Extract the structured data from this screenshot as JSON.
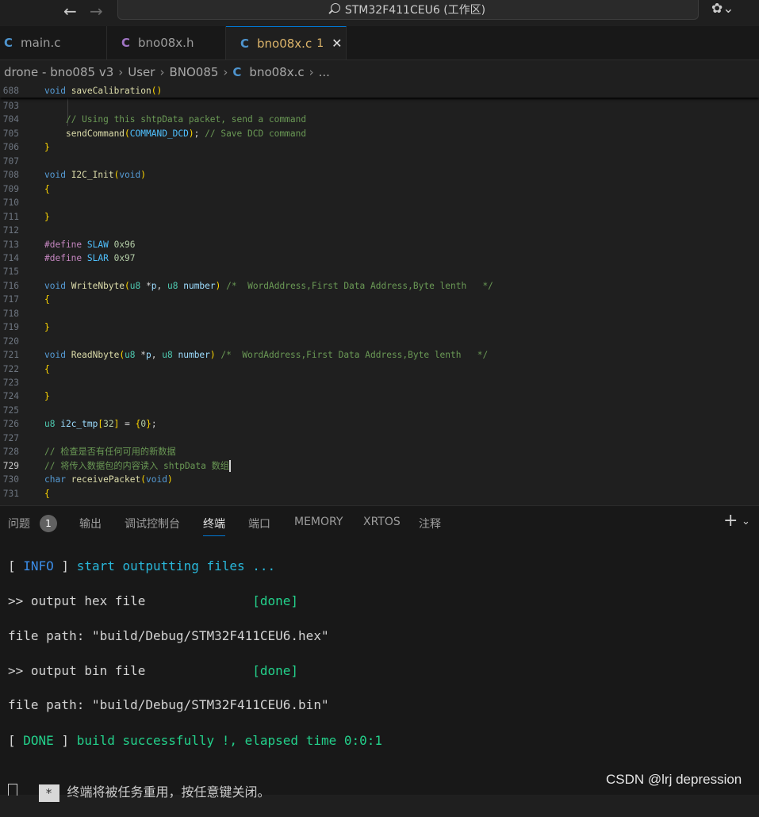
{
  "titlebar": {
    "command_center": "STM32F411CEU6 (工作区)",
    "back_glyph": "←",
    "forward_glyph": "→",
    "copilot_glyph": "✿⌄"
  },
  "tabs": [
    {
      "label": "main.c",
      "icon": "C"
    },
    {
      "label": "bno08x.h",
      "icon": "C"
    },
    {
      "label": "bno08x.c",
      "icon": "C",
      "badge": "1",
      "active": true
    }
  ],
  "colors": {
    "c_icon_source": "#4e94ce",
    "c_icon_header": "#a074c4",
    "accent": "#0078d4",
    "modified": "#dcb46a"
  },
  "breadcrumb": {
    "items": [
      "drone - bno085 v3",
      "User",
      "BNO085"
    ],
    "file_icon": "C",
    "file": "bno08x.c",
    "tail": "..."
  },
  "editor": {
    "sticky": {
      "num": "688",
      "code": [
        [
          "kw",
          "void "
        ],
        [
          "fn",
          "saveCalibration"
        ],
        [
          "pr",
          "()"
        ]
      ]
    },
    "lines": [
      {
        "num": "703",
        "code": []
      },
      {
        "num": "704",
        "code": [
          [
            "tx",
            "    "
          ],
          [
            "cm",
            "// Using this shtpData packet, send a command"
          ]
        ]
      },
      {
        "num": "705",
        "code": [
          [
            "tx",
            "    "
          ],
          [
            "fn",
            "sendCommand"
          ],
          [
            "pr",
            "("
          ],
          [
            "cn",
            "COMMAND_DCD"
          ],
          [
            "pr",
            ")"
          ],
          [
            "tx",
            "; "
          ],
          [
            "cm",
            "// Save DCD command"
          ]
        ]
      },
      {
        "num": "706",
        "code": [
          [
            "pr",
            "}"
          ]
        ]
      },
      {
        "num": "707",
        "code": []
      },
      {
        "num": "708",
        "code": [
          [
            "kw",
            "void "
          ],
          [
            "fn",
            "I2C_Init"
          ],
          [
            "pr",
            "("
          ],
          [
            "kw",
            "void"
          ],
          [
            "pr",
            ")"
          ]
        ]
      },
      {
        "num": "709",
        "code": [
          [
            "pr",
            "{"
          ]
        ]
      },
      {
        "num": "710",
        "code": []
      },
      {
        "num": "711",
        "code": [
          [
            "pr",
            "}"
          ]
        ]
      },
      {
        "num": "712",
        "code": []
      },
      {
        "num": "713",
        "code": [
          [
            "mc",
            "#define "
          ],
          [
            "cn",
            "SLAW "
          ],
          [
            "nm",
            "0x96"
          ]
        ]
      },
      {
        "num": "714",
        "code": [
          [
            "mc",
            "#define "
          ],
          [
            "cn",
            "SLAR "
          ],
          [
            "nm",
            "0x97"
          ]
        ]
      },
      {
        "num": "715",
        "code": []
      },
      {
        "num": "716",
        "code": [
          [
            "kw",
            "void "
          ],
          [
            "fn",
            "WriteNbyte"
          ],
          [
            "pr",
            "("
          ],
          [
            "tp",
            "u8 "
          ],
          [
            "tx",
            "*"
          ],
          [
            "vr",
            "p"
          ],
          [
            "tx",
            ", "
          ],
          [
            "tp",
            "u8 "
          ],
          [
            "vr",
            "number"
          ],
          [
            "pr",
            ")"
          ],
          [
            "tx",
            " "
          ],
          [
            "cm",
            "/*  WordAddress,First Data Address,Byte lenth   */"
          ]
        ]
      },
      {
        "num": "717",
        "code": [
          [
            "pr",
            "{"
          ]
        ]
      },
      {
        "num": "718",
        "code": []
      },
      {
        "num": "719",
        "code": [
          [
            "pr",
            "}"
          ]
        ]
      },
      {
        "num": "720",
        "code": []
      },
      {
        "num": "721",
        "code": [
          [
            "kw",
            "void "
          ],
          [
            "fn",
            "ReadNbyte"
          ],
          [
            "pr",
            "("
          ],
          [
            "tp",
            "u8 "
          ],
          [
            "tx",
            "*"
          ],
          [
            "vr",
            "p"
          ],
          [
            "tx",
            ", "
          ],
          [
            "tp",
            "u8 "
          ],
          [
            "vr",
            "number"
          ],
          [
            "pr",
            ")"
          ],
          [
            "tx",
            " "
          ],
          [
            "cm",
            "/*  WordAddress,First Data Address,Byte lenth   */"
          ]
        ]
      },
      {
        "num": "722",
        "code": [
          [
            "pr",
            "{"
          ]
        ]
      },
      {
        "num": "723",
        "code": []
      },
      {
        "num": "724",
        "code": [
          [
            "pr",
            "}"
          ]
        ]
      },
      {
        "num": "725",
        "code": []
      },
      {
        "num": "726",
        "code": [
          [
            "tp",
            "u8 "
          ],
          [
            "vr",
            "i2c_tmp"
          ],
          [
            "pr",
            "["
          ],
          [
            "nm",
            "32"
          ],
          [
            "pr",
            "]"
          ],
          [
            "tx",
            " = "
          ],
          [
            "pr",
            "{"
          ],
          [
            "nm",
            "0"
          ],
          [
            "pr",
            "}"
          ],
          [
            "tx",
            ";"
          ]
        ]
      },
      {
        "num": "727",
        "code": []
      },
      {
        "num": "728",
        "code": [
          [
            "cm",
            "// 检查是否有任何可用的新数据"
          ]
        ]
      },
      {
        "num": "729",
        "code": [
          [
            "cm",
            "// 将传入数据包的内容读入 shtpData 数组"
          ]
        ],
        "current": true
      },
      {
        "num": "730",
        "code": [
          [
            "kw",
            "char "
          ],
          [
            "fn",
            "receivePacket"
          ],
          [
            "pr",
            "("
          ],
          [
            "kw",
            "void"
          ],
          [
            "pr",
            ")"
          ]
        ]
      },
      {
        "num": "731",
        "code": [
          [
            "pr",
            "{"
          ]
        ]
      }
    ]
  },
  "panel": {
    "tabs": [
      "问题",
      "输出",
      "调试控制台",
      "终端",
      "端口",
      "MEMORY",
      "XRTOS",
      "注释"
    ],
    "active_tab": "终端",
    "problems_count": "1",
    "plus_glyph": "+",
    "chevron_glyph": "⌄"
  },
  "terminal": {
    "lines": [
      [
        [
          "tx",
          "[ "
        ],
        [
          "blue",
          "INFO"
        ],
        [
          "tx",
          " ] "
        ],
        [
          "cyan",
          "start outputting files ..."
        ]
      ],
      [
        [
          "tx",
          ">> output hex file              "
        ],
        [
          "green",
          "[done]"
        ]
      ],
      [
        [
          "tx",
          "file path: \"build/Debug/STM32F411CEU6.hex\""
        ]
      ],
      [
        [
          "tx",
          ">> output bin file              "
        ],
        [
          "green",
          "[done]"
        ]
      ],
      [
        [
          "tx",
          "file path: \"build/Debug/STM32F411CEU6.bin\""
        ]
      ],
      [
        [
          "tx",
          "[ "
        ],
        [
          "green",
          "DONE"
        ],
        [
          "tx",
          " ] "
        ],
        [
          "green",
          "build successfully !, elapsed time 0:0:1"
        ]
      ]
    ],
    "reuse_star": "*",
    "reuse_notice": "终端将被任务重用，按任意键关闭。"
  },
  "watermark": "CSDN @lrj  depression"
}
